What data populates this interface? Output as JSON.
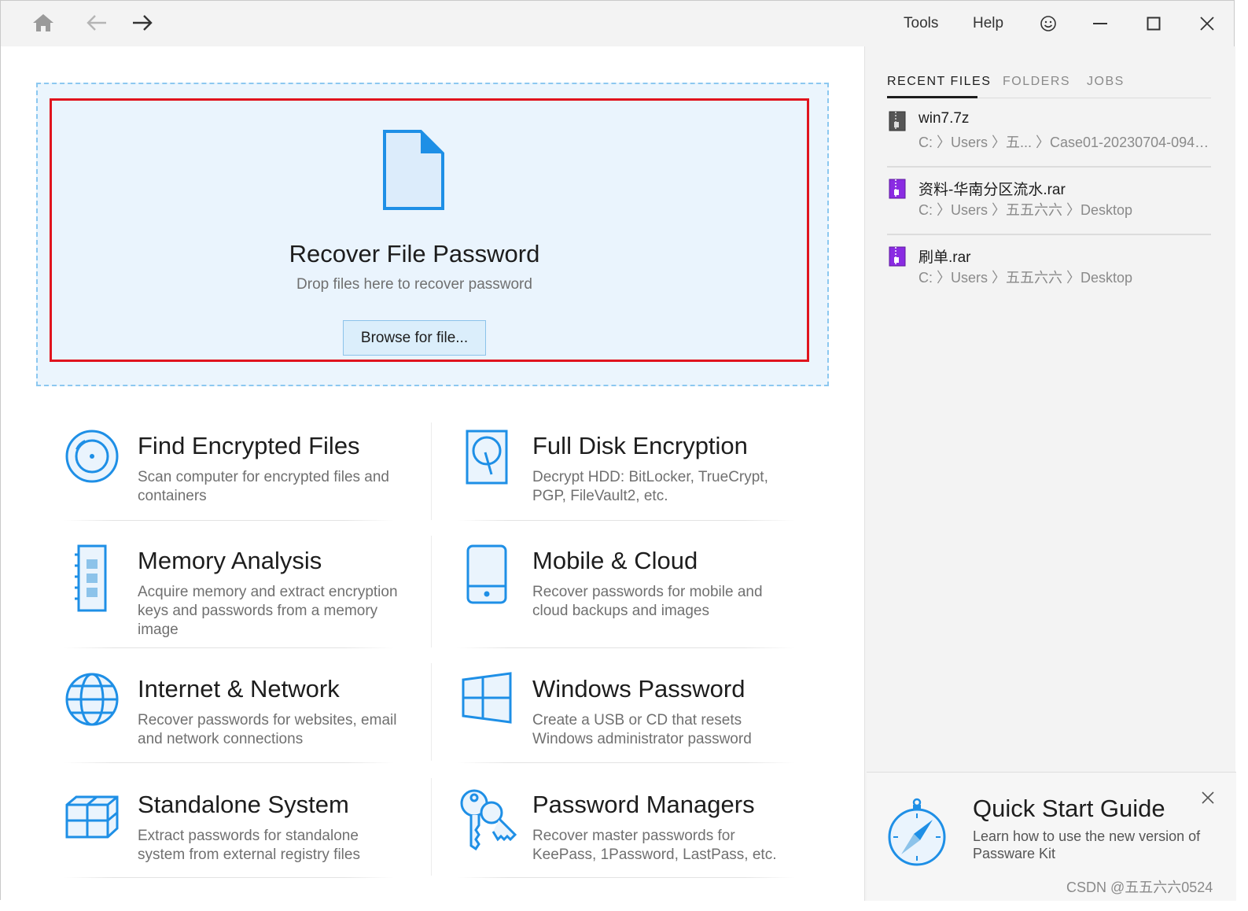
{
  "titlebar": {
    "menu": {
      "tools": "Tools",
      "help": "Help"
    }
  },
  "dropzone": {
    "title": "Recover File Password",
    "subtitle": "Drop files here to recover password",
    "browse_label": "Browse for file..."
  },
  "tiles": [
    {
      "title": "Find Encrypted Files",
      "desc": "Scan computer for encrypted files and containers"
    },
    {
      "title": "Full Disk Encryption",
      "desc": "Decrypt HDD: BitLocker, TrueCrypt, PGP, FileVault2, etc."
    },
    {
      "title": "Memory Analysis",
      "desc": "Acquire memory and extract encryption keys and passwords from a memory image"
    },
    {
      "title": "Mobile & Cloud",
      "desc": "Recover passwords for mobile and cloud backups and images"
    },
    {
      "title": "Internet & Network",
      "desc": "Recover passwords for websites, email and network connections"
    },
    {
      "title": "Windows Password",
      "desc": "Create a USB or CD that resets Windows administrator password"
    },
    {
      "title": "Standalone System",
      "desc": "Extract passwords for standalone system from external registry files"
    },
    {
      "title": "Password Managers",
      "desc": "Recover master passwords for KeePass, 1Password, LastPass, etc."
    }
  ],
  "sidebar": {
    "tabs": [
      "RECENT FILES",
      "FOLDERS",
      "JOBS"
    ],
    "recent": [
      {
        "name": "win7.7z",
        "path": "C: 〉Users 〉五... 〉Case01-20230704-0940..."
      },
      {
        "name": "资料-华南分区流水.rar",
        "path": "C: 〉Users 〉五五六六 〉Desktop"
      },
      {
        "name": "刷单.rar",
        "path": "C: 〉Users 〉五五六六 〉Desktop"
      }
    ]
  },
  "quickstart": {
    "title": "Quick Start Guide",
    "desc": "Learn how to use the new version of Passware Kit"
  },
  "watermark": "CSDN @五五六六0524",
  "colors": {
    "accent": "#1e8fe6",
    "accent_light": "#dbeefb",
    "highlight_border": "#e0141e",
    "archive_purple": "#8a2be2"
  }
}
